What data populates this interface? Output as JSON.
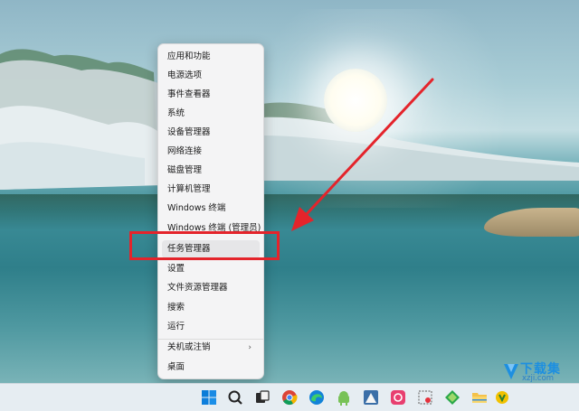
{
  "context_menu": {
    "items": [
      {
        "label": "应用和功能"
      },
      {
        "label": "电源选项"
      },
      {
        "label": "事件查看器"
      },
      {
        "label": "系统"
      },
      {
        "label": "设备管理器"
      },
      {
        "label": "网络连接"
      },
      {
        "label": "磁盘管理"
      },
      {
        "label": "计算机管理"
      },
      {
        "label": "Windows 终端"
      },
      {
        "label": "Windows 终端 (管理员)"
      },
      {
        "label": "任务管理器",
        "highlighted": true
      },
      {
        "label": "设置"
      },
      {
        "label": "文件资源管理器"
      },
      {
        "label": "搜索"
      },
      {
        "label": "运行"
      },
      {
        "label": "关机或注销",
        "has_submenu": true,
        "chevron": "›"
      },
      {
        "label": "桌面"
      }
    ]
  },
  "annotation": {
    "highlight_color": "#e4242b",
    "arrow_color": "#e4242b"
  },
  "taskbar": {
    "background": "#e6edf2",
    "icons": [
      "windows-start-icon",
      "search-icon",
      "task-view-icon",
      "chrome-icon",
      "edge-icon",
      "android-icon",
      "xz-app-icon",
      "pink-app-icon",
      "snipping-tool-icon",
      "store-icon",
      "file-explorer-icon",
      "yellow-app-icon"
    ]
  },
  "watermark": {
    "title": "下载集",
    "url": "xzji.com"
  }
}
